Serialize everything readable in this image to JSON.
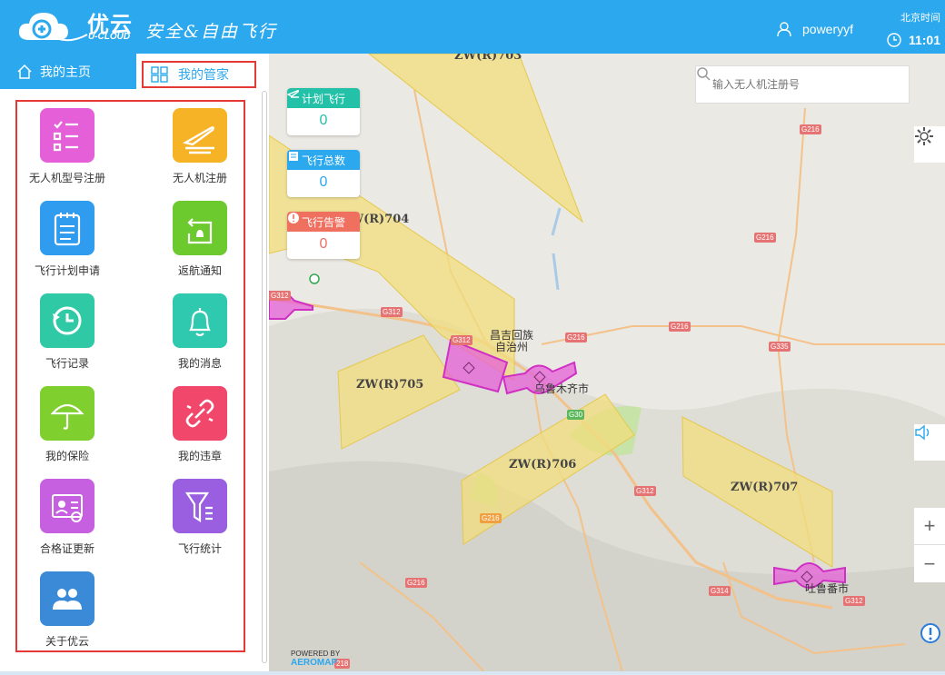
{
  "header": {
    "brand_cn": "优云",
    "brand_en": "U-CLOUD",
    "slogan": "安全&自由飞行",
    "username": "poweryyf",
    "time_label": "北京时间",
    "time": "11:01"
  },
  "tabs": {
    "home": "我的主页",
    "manager": "我的管家"
  },
  "menu": [
    {
      "label": "无人机型号注册",
      "color": "#e55fd8",
      "icon": "checklist-icon"
    },
    {
      "label": "无人机注册",
      "color": "#f6b325",
      "icon": "plane-takeoff-icon"
    },
    {
      "label": "飞行计划申请",
      "color": "#2f9cf0",
      "icon": "clipboard-icon"
    },
    {
      "label": "返航通知",
      "color": "#6cc92e",
      "icon": "return-bell-icon"
    },
    {
      "label": "飞行记录",
      "color": "#2fc9a5",
      "icon": "history-icon"
    },
    {
      "label": "我的消息",
      "color": "#2fc9b0",
      "icon": "bell-icon"
    },
    {
      "label": "我的保险",
      "color": "#7fcf2f",
      "icon": "umbrella-icon"
    },
    {
      "label": "我的违章",
      "color": "#f0476a",
      "icon": "broken-link-icon"
    },
    {
      "label": "合格证更新",
      "color": "#c65fe0",
      "icon": "id-card-icon"
    },
    {
      "label": "飞行统计",
      "color": "#9a5fe0",
      "icon": "filter-icon"
    },
    {
      "label": "关于优云",
      "color": "#3a8ad8",
      "icon": "users-icon"
    }
  ],
  "stats": [
    {
      "label": "计划飞行",
      "value": "0",
      "color": "#22c1a8",
      "valueColor": "#22c1a8",
      "icon": "plane-icon"
    },
    {
      "label": "飞行总数",
      "value": "0",
      "color": "#2ba8ee",
      "valueColor": "#2ba8ee",
      "icon": "calendar-icon"
    },
    {
      "label": "飞行告警",
      "value": "0",
      "color": "#f07060",
      "valueColor": "#f07060",
      "icon": "alert-icon"
    }
  ],
  "search": {
    "placeholder": "输入无人机注册号"
  },
  "map": {
    "zones": [
      "ZW(R)703",
      "ZW(R)704",
      "ZW(R)705",
      "ZW(R)706",
      "ZW(R)707"
    ],
    "cities": [
      "昌吉回族",
      "自治州",
      "乌鲁木齐市",
      "吐鲁番市"
    ],
    "roads": [
      "G216",
      "G216",
      "G312",
      "G312",
      "G312",
      "G216",
      "G335",
      "G216",
      "G30",
      "G312",
      "G216",
      "G216",
      "G314",
      "G312",
      "218"
    ],
    "powered_by": "POWERED BY",
    "powered_brand": "AEROMAP"
  }
}
